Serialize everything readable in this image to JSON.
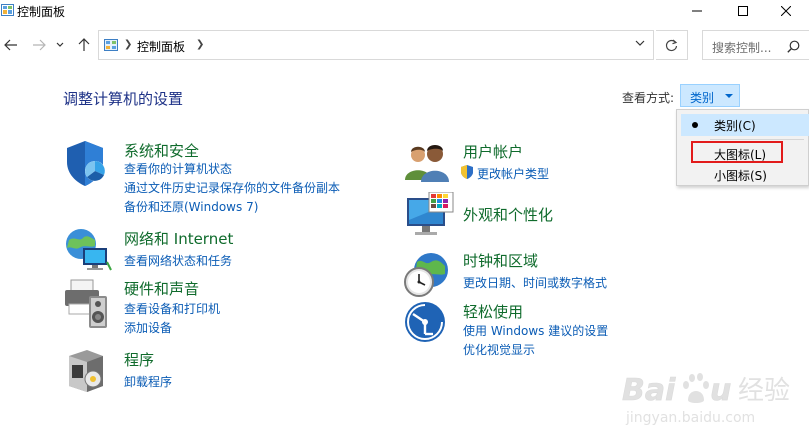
{
  "window": {
    "title": "控制面板",
    "icon": "control-panel-icon",
    "buttons": [
      "minimize-icon",
      "maximize-icon",
      "close-icon"
    ]
  },
  "address": {
    "breadcrumb": "控制面板",
    "search_placeholder": "搜索控制..."
  },
  "header": {
    "title": "调整计算机的设置",
    "view_label": "查看方式:",
    "view_value": "类别"
  },
  "view_menu": {
    "items": [
      {
        "label": "类别(C)",
        "selected": true
      },
      {
        "label": "大图标(L)",
        "selected": false,
        "highlighted": true
      },
      {
        "label": "小图标(S)",
        "selected": false
      }
    ]
  },
  "categories_left": [
    {
      "name": "系统和安全",
      "icon": "shield-icon",
      "links": [
        "查看你的计算机状态",
        "通过文件历史记录保存你的文件备份副本",
        "备份和还原(Windows 7)"
      ]
    },
    {
      "name": "网络和 Internet",
      "icon": "network-globe-icon",
      "links": [
        "查看网络状态和任务"
      ]
    },
    {
      "name": "硬件和声音",
      "icon": "printer-speaker-icon",
      "links": [
        "查看设备和打印机",
        "添加设备"
      ]
    },
    {
      "name": "程序",
      "icon": "programs-box-icon",
      "links": [
        "卸载程序"
      ]
    }
  ],
  "categories_right": [
    {
      "name": "用户帐户",
      "icon": "users-icon",
      "links": [
        "更改帐户类型"
      ]
    },
    {
      "name": "外观和个性化",
      "icon": "monitor-palette-icon",
      "links": []
    },
    {
      "name": "时钟和区域",
      "icon": "clock-globe-icon",
      "links": [
        "更改日期、时间或数字格式"
      ]
    },
    {
      "name": "轻松使用",
      "icon": "ease-of-access-icon",
      "links": [
        "使用 Windows 建议的设置",
        "优化视觉显示"
      ]
    }
  ],
  "colors": {
    "category_name": "#0f6b2c",
    "link": "#0b5cb5",
    "title": "#1e3287",
    "highlight": "#e21b1b"
  }
}
